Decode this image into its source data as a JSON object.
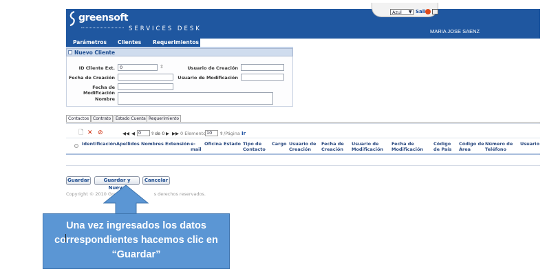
{
  "header": {
    "logo_text": "greensoft",
    "logo_tagline": "soluciones informáticas",
    "product_name": "SERVICES DESK",
    "theme_select": "Azul",
    "logout_label": "Salir",
    "user_name": "MARIA JOSE SAENZ",
    "brand_color": "#1f57a0"
  },
  "menu": {
    "items": [
      "Parámetros",
      "Clientes",
      "Requerimientos"
    ]
  },
  "panel": {
    "title": "Nuevo Cliente",
    "fields": {
      "id_cliente_label": "ID Cliente Ext.",
      "id_cliente_value": "0",
      "fecha_creacion_label": "Fecha de Creación",
      "fecha_modificacion_label": "Fecha de Modificación",
      "nombre_label": "Nombre",
      "usuario_creacion_label": "Usuario de Creación",
      "usuario_modificacion_label": "Usuario de Modificación"
    }
  },
  "tabs": [
    "Contactos",
    "Contrato",
    "Estado Cuenta",
    "Requerimiento"
  ],
  "grid": {
    "toolbar_icons": [
      "new-icon",
      "delete-icon",
      "filter-icon"
    ],
    "pager": {
      "page_value": "0",
      "of_label": "de 0",
      "elements_label": "0 Elementos",
      "rows_value": "10",
      "per_page_label": "/Página",
      "go_label": "Ir"
    },
    "columns": [
      "Identificación",
      "Apellidos",
      "Nombres",
      "Extensión",
      "e-\nmail",
      "Oficina",
      "Estado",
      "Tipo de\nContacto",
      "Cargo",
      "Usuario de\nCreación",
      "Fecha de\nCreación",
      "Usuario de\nModificación",
      "Fecha de\nModificación",
      "Código\nde País",
      "Código de\nÁrea",
      "Número de\nTeléfono",
      "Usuario"
    ]
  },
  "buttons": {
    "guardar": "Guardar",
    "guardar_nuevo": "Guardar y Nuevo",
    "cancelar": "Cancelar"
  },
  "footer": {
    "copyright_start": "Copyright © 2010 Green",
    "copyright_end": "s derechos reservados."
  },
  "callout": {
    "text": "Una vez ingresados los datos correspondientes hacemos clic en “Guardar”",
    "color": "#5b96d4"
  }
}
